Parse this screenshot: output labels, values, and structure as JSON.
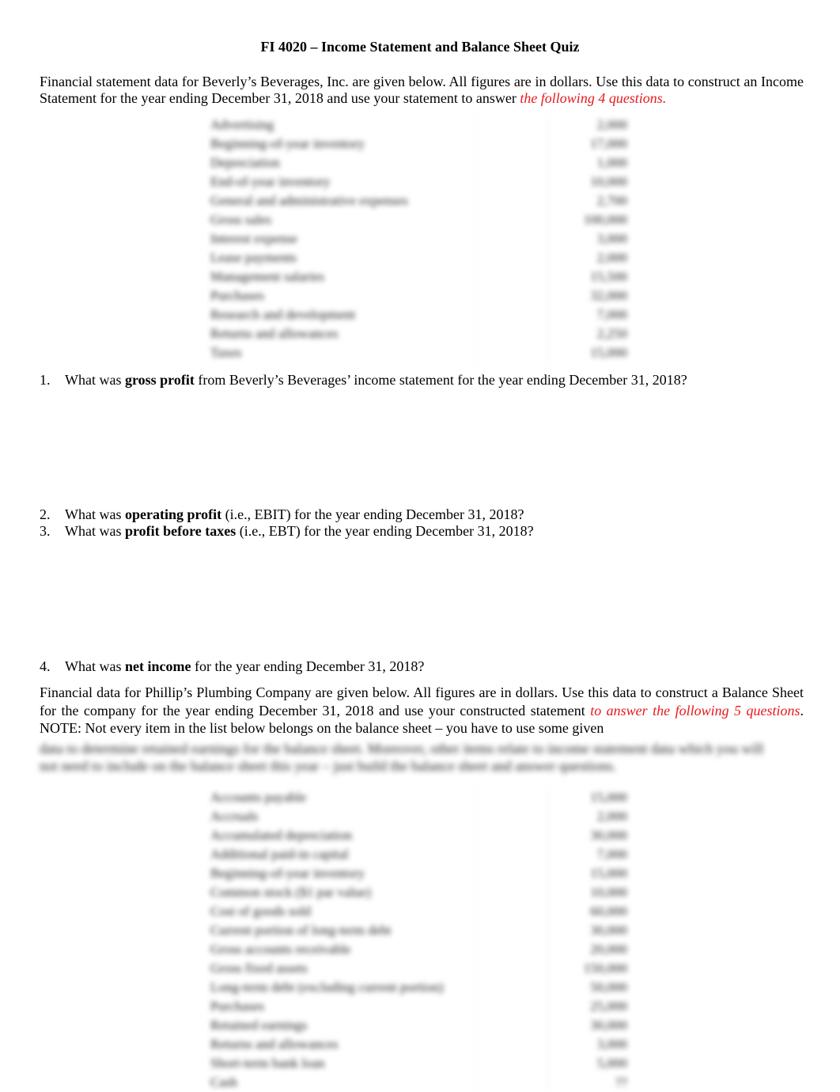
{
  "title": "FI 4020 – Income Statement and Balance Sheet Quiz",
  "intro1": {
    "text": "Financial statement data for Beverly’s Beverages, Inc. are given below. All figures are in dollars. Use this data to construct an Income Statement for the year ending December 31, 2018 and use your statement to answer ",
    "highlight": "the following 4 questions."
  },
  "income_table": {
    "rows": [
      {
        "label": "Advertising",
        "value": "2,000"
      },
      {
        "label": "Beginning-of-year inventory",
        "value": "17,000"
      },
      {
        "label": "Depreciation",
        "value": "1,000"
      },
      {
        "label": "End-of-year inventory",
        "value": "10,000"
      },
      {
        "label": "General and administrative expenses",
        "value": "2,700"
      },
      {
        "label": "Gross sales",
        "value": "100,000"
      },
      {
        "label": "Interest expense",
        "value": "3,000"
      },
      {
        "label": "Lease payments",
        "value": "2,000"
      },
      {
        "label": "Management salaries",
        "value": "15,500"
      },
      {
        "label": "Purchases",
        "value": "32,000"
      },
      {
        "label": "Research and development",
        "value": "7,000"
      },
      {
        "label": "Returns and allowances",
        "value": "2,250"
      },
      {
        "label": "Taxes",
        "value": "15,000"
      }
    ]
  },
  "questions": [
    {
      "num": "1.",
      "pre": "What was ",
      "bold": "gross profit",
      "post": " from Beverly’s Beverages’ income statement for the year ending December 31, 2018?"
    },
    {
      "num": "2.",
      "pre": "What was ",
      "bold": "operating profit",
      "post": " (i.e., EBIT) for the year ending December 31, 2018?"
    },
    {
      "num": "3.",
      "pre": "What was ",
      "bold": "profit before taxes",
      "post": " (i.e., EBT) for the year ending December 31, 2018?"
    },
    {
      "num": "4.",
      "pre": "What was ",
      "bold": "net income",
      "post": " for the year ending December 31, 2018?"
    }
  ],
  "intro2": {
    "text": "Financial data for Phillip’s Plumbing Company are given below. All figures are in dollars. Use this data to construct a Balance Sheet for the company for the year ending December 31, 2018 and use your constructed statement ",
    "highlight": "to answer the following 5 questions",
    "after": ". NOTE: Not every item in the list below belongs on the balance sheet – you have to use some given",
    "blurred_line1": "data to determine retained earnings for the balance sheet. Moreover, other items relate to income statement data which you will",
    "blurred_line2": "not need to include on the balance sheet this year – just build the balance sheet and answer questions."
  },
  "balance_table": {
    "rows": [
      {
        "label": "Accounts payable",
        "value": "15,000"
      },
      {
        "label": "Accruals",
        "value": "2,000"
      },
      {
        "label": "Accumulated depreciation",
        "value": "30,000"
      },
      {
        "label": "Additional paid-in capital",
        "value": "7,000"
      },
      {
        "label": "Beginning-of-year inventory",
        "value": "15,000"
      },
      {
        "label": "Common stock ($1 par value)",
        "value": "10,000"
      },
      {
        "label": "Cost of goods sold",
        "value": "60,000"
      },
      {
        "label": "Current portion of long-term debt",
        "value": "30,000"
      },
      {
        "label": "Gross accounts receivable",
        "value": "20,000"
      },
      {
        "label": "Gross fixed assets",
        "value": "150,000"
      },
      {
        "label": "Long-term debt (excluding current portion)",
        "value": "50,000"
      },
      {
        "label": "Purchases",
        "value": "25,000"
      },
      {
        "label": "Retained earnings",
        "value": "30,000"
      },
      {
        "label": "Returns and allowances",
        "value": "3,000"
      },
      {
        "label": "Short-term bank loan",
        "value": "5,000"
      },
      {
        "label": "Cash",
        "value": "??"
      }
    ]
  }
}
